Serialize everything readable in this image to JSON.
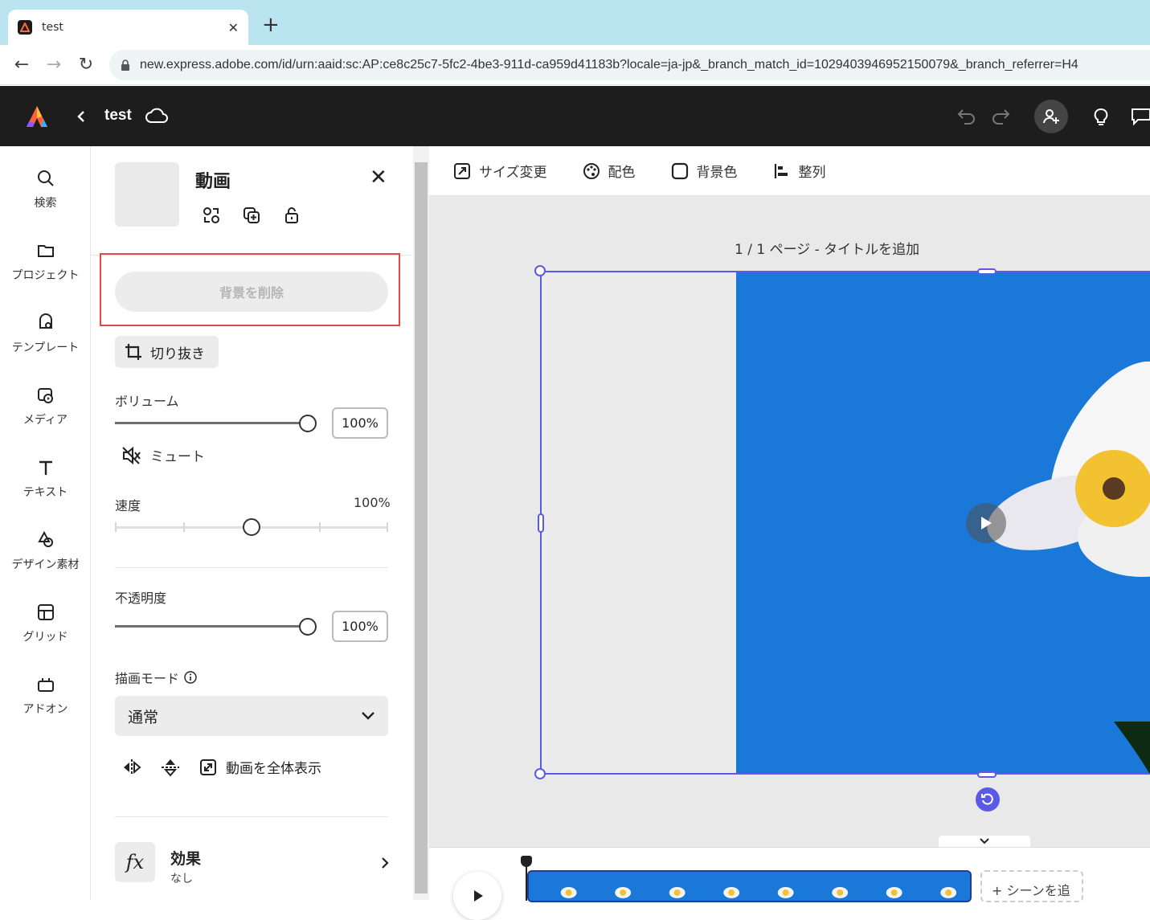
{
  "browser": {
    "tab_title": "test",
    "url": "new.express.adobe.com/id/urn:aaid:sc:AP:ce8c25c7-5fc2-4be3-911d-ca959d41183b?locale=ja-jp&_branch_match_id=1029403946952150079&_branch_referrer=H4"
  },
  "app": {
    "doc_title": "test"
  },
  "rail": {
    "items": [
      {
        "label": "検索",
        "icon": "search-icon"
      },
      {
        "label": "プロジェクト",
        "icon": "folder-icon"
      },
      {
        "label": "テンプレート",
        "icon": "template-icon"
      },
      {
        "label": "メディア",
        "icon": "media-icon"
      },
      {
        "label": "テキスト",
        "icon": "text-icon"
      },
      {
        "label": "デザイン素材",
        "icon": "design-assets-icon"
      },
      {
        "label": "グリッド",
        "icon": "grid-icon"
      },
      {
        "label": "アドオン",
        "icon": "addon-icon"
      }
    ]
  },
  "panel": {
    "title": "動画",
    "remove_bg": "背景を削除",
    "crop": "切り抜き",
    "volume_label": "ボリューム",
    "volume_value": "100%",
    "volume_level": 1.0,
    "mute": "ミュート",
    "speed_label": "速度",
    "speed_value": "100%",
    "speed_level": 0.5,
    "opacity_label": "不透明度",
    "opacity_value": "100%",
    "opacity_level": 1.0,
    "blend_label": "描画モード",
    "blend_value": "通常",
    "fit_label": "動画を全体表示",
    "effects_title": "効果",
    "effects_value": "なし"
  },
  "canvas": {
    "toolbar": {
      "resize": "サイズ変更",
      "color": "配色",
      "bg_color": "背景色",
      "align": "整列"
    },
    "page_title": "1 / 1 ページ - タイトルを追加",
    "add_scene": "+ シーンを追"
  },
  "colors": {
    "accent": "#5a5ae6",
    "video_bg": "#1a78d8",
    "highlight": "#e04a4a"
  }
}
